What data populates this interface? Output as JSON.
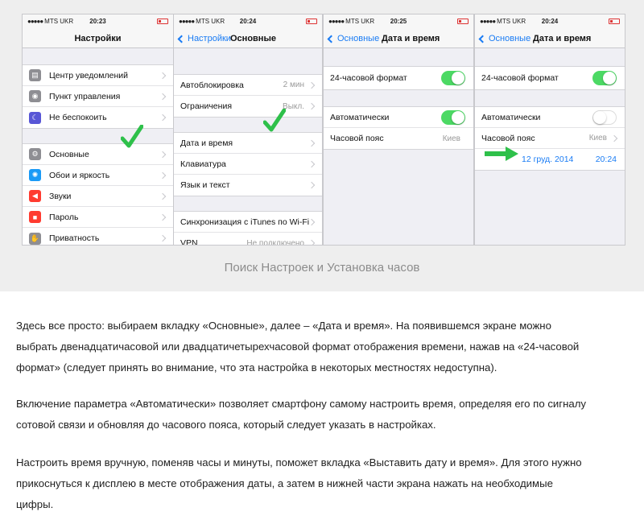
{
  "status": {
    "carrier": "MTS UKR",
    "times": [
      "20:23",
      "20:24",
      "20:25",
      "20:24"
    ]
  },
  "screen1": {
    "title": "Настройки",
    "group1": [
      {
        "label": "Центр уведомлений",
        "icon": "notification-center-icon",
        "color": "#8e8e93"
      },
      {
        "label": "Пункт управления",
        "icon": "control-center-icon",
        "color": "#8e8e93"
      },
      {
        "label": "Не беспокоить",
        "icon": "moon-icon",
        "color": "#5856d6"
      }
    ],
    "group2": [
      {
        "label": "Основные",
        "icon": "gear-icon",
        "color": "#8e8e93"
      },
      {
        "label": "Обои и яркость",
        "icon": "wallpaper-icon",
        "color": "#1a9af6"
      },
      {
        "label": "Звуки",
        "icon": "speaker-icon",
        "color": "#ff3b30"
      },
      {
        "label": "Пароль",
        "icon": "lock-icon",
        "color": "#ff3b30"
      },
      {
        "label": "Приватность",
        "icon": "hand-icon",
        "color": "#8e8e93"
      }
    ]
  },
  "screen2": {
    "back": "Настройки",
    "title": "Основные",
    "group1": [
      {
        "label": "Автоблокировка",
        "value": "2 мин"
      },
      {
        "label": "Ограничения",
        "value": "Выкл."
      }
    ],
    "group2": [
      {
        "label": "Дата и время",
        "value": ""
      },
      {
        "label": "Клавиатура",
        "value": ""
      },
      {
        "label": "Язык и текст",
        "value": ""
      }
    ],
    "group3": [
      {
        "label": "Синхронизация с iTunes по Wi-Fi",
        "value": ""
      },
      {
        "label": "VPN",
        "value": "Не подключено"
      }
    ]
  },
  "screen3": {
    "back": "Основные",
    "title": "Дата и время",
    "format_label": "24-часовой формат",
    "format_on": true,
    "auto_label": "Автоматически",
    "auto_on": true,
    "timezone_label": "Часовой пояс",
    "timezone_value": "Киев"
  },
  "screen4": {
    "back": "Основные",
    "title": "Дата и время",
    "format_label": "24-часовой формат",
    "format_on": true,
    "auto_label": "Автоматически",
    "auto_on": false,
    "timezone_label": "Часовой пояс",
    "timezone_value": "Киев",
    "date_value": "12 груд. 2014",
    "time_value": "20:24"
  },
  "colors": {
    "accent_blue": "#1a7cf4",
    "toggle_green": "#4cd964",
    "checkmark_green": "#2ec04a"
  },
  "caption": "Поиск Настроек и Установка часов",
  "paragraphs": [
    [
      "Здесь все просто: выбираем вкладку «Основные», далее – «Дата и время». На появившемся экране можно",
      "выбрать двенадцатичасовой или двадцатичетырехчасовой формат отображения времени, нажав на «24-часовой",
      "формат» (следует принять во внимание, что эта настройка в некоторых местностях недоступна)."
    ],
    [
      "Включение параметра «Автоматически» позволяет смартфону самому настроить время, определяя его по сигналу",
      "сотовой связи и обновляя до часового пояса, который следует указать в настройках."
    ],
    [
      "Настроить время вручную, поменяв часы и минуты, поможет вкладка «Выставить дату и время». Для этого нужно",
      "прикоснуться к дисплею в месте отображения даты, а затем в нижней части экрана нажать на необходимые",
      "цифры."
    ]
  ]
}
